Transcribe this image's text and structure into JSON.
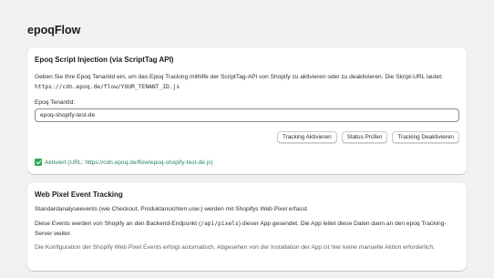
{
  "app": {
    "title": "epoqFlow"
  },
  "script_card": {
    "title": "Epoq Script Injection (via ScriptTag API)",
    "description": "Geben Sie Ihre Epoq Tenantid ein, um das Epoq Tracking mithilfe der ScriptTag-API von Shopify zu aktivieren oder zu deaktivieren. Die Skript-URL lautet:",
    "script_url": "https://cdn.epoq.de/flow/YOUR_TENANT_ID.js",
    "tenant_label": "Epoq TenantId:",
    "tenant_value": "epoq-shopify-test-de",
    "buttons": {
      "activate": "Tracking Aktivieren",
      "check": "Status Prüfen",
      "deactivate": "Tracking Deaktivieren"
    },
    "status_text": "Aktiviert (URL: https://cdn.epoq.de/flow/epoq-shopify-test-de.js)",
    "status_icon": "check-icon",
    "status_color": "#29845a"
  },
  "pixel_card": {
    "title": "Web Pixel Event Tracking",
    "para1": "Standardanalyseevents (wie Checkout, Produktansichten usw.) werden mit Shopifys Web Pixel erfasst.",
    "para2_before": "Diese Events werden von Shopify an den Backend-Endpunkt (",
    "para2_code": "/api/pixels",
    "para2_after": ") dieser App gesendet. Die App leitet diese Daten dann an den epoq Tracking-Server weiter.",
    "para3": "Die Konfiguration der Shopify Web Pixel Events erfolgt automatisch. Abgesehen von der Installation der App ist hier keine manuelle Aktion erforderlich."
  }
}
